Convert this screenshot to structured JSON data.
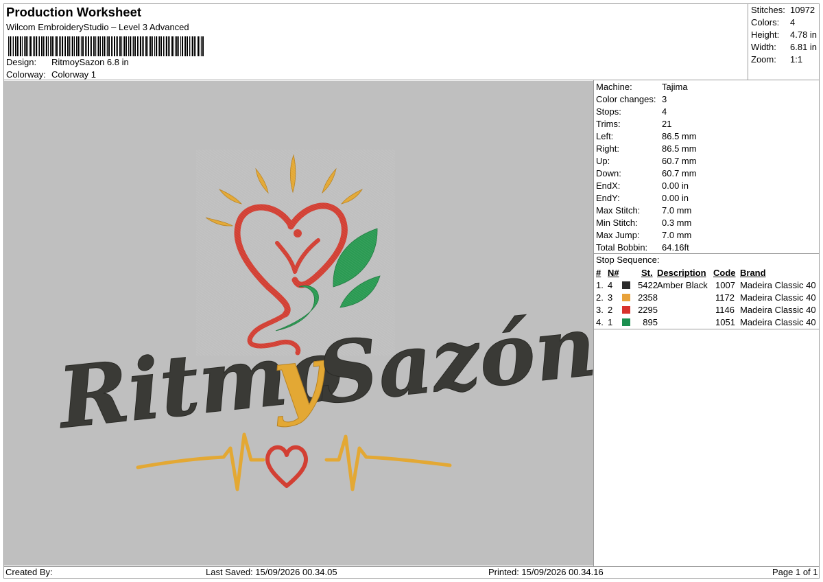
{
  "header": {
    "title": "Production Worksheet",
    "software": "Wilcom EmbroideryStudio – Level 3 Advanced",
    "design_label": "Design:",
    "design_value": "RitmoySazon 6.8 in",
    "colorway_label": "Colorway:",
    "colorway_value": "Colorway 1"
  },
  "summary": [
    {
      "label": "Stitches:",
      "value": "10972"
    },
    {
      "label": "Colors:",
      "value": "4"
    },
    {
      "label": "Height:",
      "value": "4.78 in"
    },
    {
      "label": "Width:",
      "value": "6.81 in"
    },
    {
      "label": "Zoom:",
      "value": "1:1"
    }
  ],
  "machine_info": [
    {
      "label": "Machine:",
      "value": "Tajima"
    },
    {
      "label": "Color changes:",
      "value": "3"
    },
    {
      "label": "Stops:",
      "value": "4"
    },
    {
      "label": "Trims:",
      "value": "21"
    },
    {
      "label": "Left:",
      "value": "86.5 mm"
    },
    {
      "label": "Right:",
      "value": "86.5 mm"
    },
    {
      "label": "Up:",
      "value": "60.7 mm"
    },
    {
      "label": "Down:",
      "value": "60.7 mm"
    },
    {
      "label": "EndX:",
      "value": "0.00 in"
    },
    {
      "label": "EndY:",
      "value": "0.00 in"
    },
    {
      "label": "Max Stitch:",
      "value": "7.0 mm"
    },
    {
      "label": "Min Stitch:",
      "value": "0.3 mm"
    },
    {
      "label": "Max Jump:",
      "value": "7.0 mm"
    },
    {
      "label": "Total Bobbin:",
      "value": "64.16ft"
    }
  ],
  "stop_sequence": {
    "title": "Stop Sequence:",
    "headers": {
      "num": "#",
      "n": "N#",
      "st": "St.",
      "description": "Description",
      "code": "Code",
      "brand": "Brand"
    },
    "rows": [
      {
        "num": "1.",
        "n": "4",
        "color": "#2b2b2b",
        "st": "5422",
        "description": "Amber Black",
        "code": "1007",
        "brand": "Madeira Classic 40"
      },
      {
        "num": "2.",
        "n": "3",
        "color": "#e8a23a",
        "st": "2358",
        "description": "",
        "code": "1172",
        "brand": "Madeira Classic 40"
      },
      {
        "num": "3.",
        "n": "2",
        "color": "#d8322d",
        "st": "2295",
        "description": "",
        "code": "1146",
        "brand": "Madeira Classic 40"
      },
      {
        "num": "4.",
        "n": "1",
        "color": "#1a8f4f",
        "st": "895",
        "description": "",
        "code": "1051",
        "brand": "Madeira Classic 40"
      }
    ]
  },
  "design_art": {
    "word_part1": "Ritmo",
    "word_part2": "y",
    "word_part3": "Sazón",
    "thread_black": "#3a3a36",
    "thread_gold": "#e3a834",
    "thread_red": "#d23f33",
    "thread_green": "#2a9a52",
    "canvas_bg": "#bfbfbf"
  },
  "footer": {
    "created_by": "Created By:",
    "last_saved": "Last Saved: 15/09/2026 00.34.05",
    "printed": "Printed: 15/09/2026 00.34.16",
    "page": "Page 1 of 1"
  }
}
